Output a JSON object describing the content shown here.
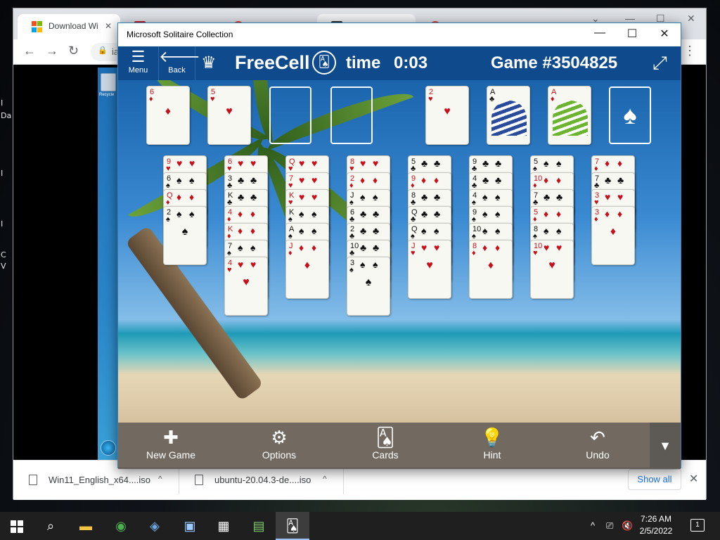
{
  "desktop": {
    "side_labels": [
      "I",
      "Da",
      "I",
      "I",
      "C",
      "V"
    ]
  },
  "browser": {
    "tabs": [
      {
        "title": "Download Wi"
      },
      {
        "title": ""
      },
      {
        "title": ""
      },
      {
        "title": ""
      },
      {
        "title": ""
      }
    ],
    "url": "ia",
    "downloads": [
      {
        "name": "Win11_English_x64....iso"
      },
      {
        "name": "ubuntu-20.04.3-de....iso"
      }
    ],
    "show_all": "Show all"
  },
  "vm": {
    "recycle_label": "Recycle"
  },
  "solitaire": {
    "window_title": "Microsoft Solitaire Collection",
    "menu_label": "Menu",
    "back_label": "Back",
    "game_name": "FreeCell",
    "time_label": "time",
    "time_value": "0:03",
    "game_number": "Game  #3504825",
    "freecells": [
      {
        "rank": "6",
        "suit": "♦",
        "color": "red"
      },
      {
        "rank": "5",
        "suit": "♥",
        "color": "red"
      },
      null,
      null
    ],
    "foundations": [
      {
        "rank": "2",
        "suit": "♥",
        "color": "red",
        "face": false
      },
      {
        "rank": "A",
        "suit": "♣",
        "color": "black",
        "face": true
      },
      {
        "rank": "A",
        "suit": "♦",
        "color": "red",
        "face": true
      },
      {
        "empty_suit": "♠"
      }
    ],
    "columns": [
      [
        {
          "rank": "9",
          "suit": "♥",
          "color": "red"
        },
        {
          "rank": "6",
          "suit": "♠",
          "color": "black"
        },
        {
          "rank": "Q",
          "suit": "♦",
          "color": "red"
        },
        {
          "rank": "2",
          "suit": "♠",
          "color": "black"
        }
      ],
      [
        {
          "rank": "6",
          "suit": "♥",
          "color": "red"
        },
        {
          "rank": "3",
          "suit": "♣",
          "color": "black"
        },
        {
          "rank": "K",
          "suit": "♣",
          "color": "black"
        },
        {
          "rank": "4",
          "suit": "♦",
          "color": "red"
        },
        {
          "rank": "K",
          "suit": "♦",
          "color": "red"
        },
        {
          "rank": "7",
          "suit": "♠",
          "color": "black"
        },
        {
          "rank": "4",
          "suit": "♥",
          "color": "red"
        }
      ],
      [
        {
          "rank": "Q",
          "suit": "♥",
          "color": "red"
        },
        {
          "rank": "7",
          "suit": "♥",
          "color": "red"
        },
        {
          "rank": "K",
          "suit": "♥",
          "color": "red"
        },
        {
          "rank": "K",
          "suit": "♠",
          "color": "black"
        },
        {
          "rank": "A",
          "suit": "♠",
          "color": "black"
        },
        {
          "rank": "J",
          "suit": "♦",
          "color": "red"
        }
      ],
      [
        {
          "rank": "8",
          "suit": "♥",
          "color": "red"
        },
        {
          "rank": "2",
          "suit": "♦",
          "color": "red"
        },
        {
          "rank": "J",
          "suit": "♠",
          "color": "black"
        },
        {
          "rank": "6",
          "suit": "♣",
          "color": "black"
        },
        {
          "rank": "2",
          "suit": "♣",
          "color": "black"
        },
        {
          "rank": "10",
          "suit": "♣",
          "color": "black"
        },
        {
          "rank": "3",
          "suit": "♠",
          "color": "black"
        }
      ],
      [
        {
          "rank": "5",
          "suit": "♣",
          "color": "black"
        },
        {
          "rank": "9",
          "suit": "♦",
          "color": "red"
        },
        {
          "rank": "8",
          "suit": "♣",
          "color": "black"
        },
        {
          "rank": "Q",
          "suit": "♣",
          "color": "black"
        },
        {
          "rank": "Q",
          "suit": "♠",
          "color": "black"
        },
        {
          "rank": "J",
          "suit": "♥",
          "color": "red"
        }
      ],
      [
        {
          "rank": "9",
          "suit": "♣",
          "color": "black"
        },
        {
          "rank": "4",
          "suit": "♣",
          "color": "black"
        },
        {
          "rank": "4",
          "suit": "♠",
          "color": "black"
        },
        {
          "rank": "9",
          "suit": "♠",
          "color": "black"
        },
        {
          "rank": "10",
          "suit": "♠",
          "color": "black"
        },
        {
          "rank": "8",
          "suit": "♦",
          "color": "red"
        }
      ],
      [
        {
          "rank": "5",
          "suit": "♠",
          "color": "black"
        },
        {
          "rank": "10",
          "suit": "♦",
          "color": "red"
        },
        {
          "rank": "7",
          "suit": "♣",
          "color": "black"
        },
        {
          "rank": "5",
          "suit": "♦",
          "color": "red"
        },
        {
          "rank": "8",
          "suit": "♠",
          "color": "black"
        },
        {
          "rank": "10",
          "suit": "♥",
          "color": "red"
        }
      ],
      [
        {
          "rank": "7",
          "suit": "♦",
          "color": "red"
        },
        {
          "rank": "7",
          "suit": "♣",
          "color": "black"
        },
        {
          "rank": "3",
          "suit": "♥",
          "color": "red"
        },
        {
          "rank": "3",
          "suit": "♦",
          "color": "red"
        }
      ]
    ],
    "toolbar": [
      {
        "label": "New Game",
        "icon": "plus-icon",
        "glyph": "✚"
      },
      {
        "label": "Options",
        "icon": "gear-icon",
        "glyph": "⚙"
      },
      {
        "label": "Cards",
        "icon": "cards-icon",
        "glyph": "🂡"
      },
      {
        "label": "Hint",
        "icon": "lightbulb-icon",
        "glyph": "💡"
      },
      {
        "label": "Undo",
        "icon": "undo-icon",
        "glyph": "↶"
      }
    ]
  },
  "taskbar": {
    "clock_time": "7:26 AM",
    "clock_date": "2/5/2022",
    "notification_count": "1"
  },
  "colors": {
    "header_blue": "#0e4a8c",
    "card_red": "#c8101c",
    "taskbar": "#1f1f1f"
  }
}
